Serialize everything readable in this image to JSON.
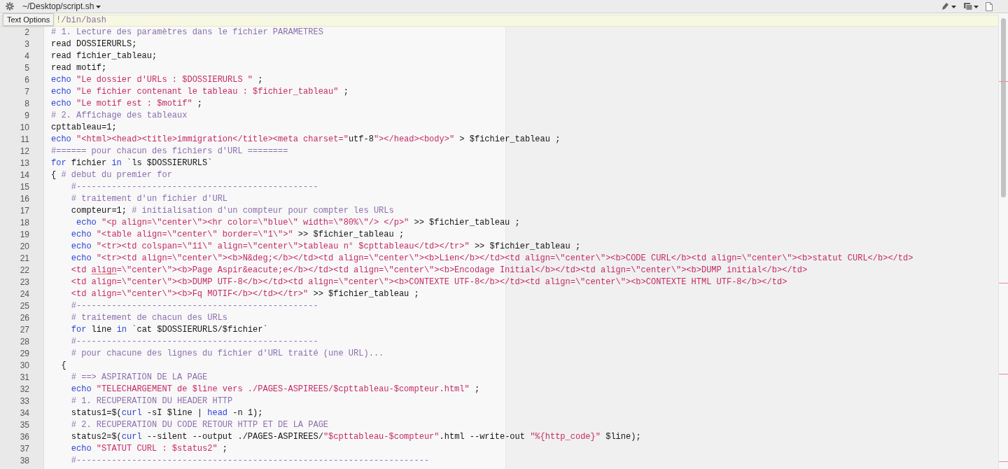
{
  "top_bar": {
    "file_path": "~/Desktop/script.sh",
    "tooltip": "Text Options"
  },
  "lines": [
    {
      "current": true,
      "tokens": [
        {
          "kind": "comment",
          "text": "!/bin/bash"
        }
      ]
    },
    {
      "n": "2",
      "current": false,
      "tokens": [
        {
          "kind": "comment",
          "text": "# 1. Lecture des paramètres dans le fichier PARAMETRES"
        }
      ]
    },
    {
      "n": "3",
      "current": false,
      "tokens": [
        {
          "kind": "plain",
          "text": "read DOSSIERURLS;"
        }
      ]
    },
    {
      "n": "4",
      "current": false,
      "tokens": [
        {
          "kind": "plain",
          "text": "read fichier_tableau;"
        }
      ]
    },
    {
      "n": "5",
      "current": false,
      "tokens": [
        {
          "kind": "plain",
          "text": "read motif;"
        }
      ]
    },
    {
      "n": "6",
      "current": false,
      "tokens": [
        {
          "kind": "keyword",
          "text": "echo "
        },
        {
          "kind": "string",
          "text": "\"Le dossier d'URLs : $DOSSIERURLS \""
        },
        {
          "kind": "plain",
          "text": " ;"
        }
      ]
    },
    {
      "n": "7",
      "current": false,
      "tokens": [
        {
          "kind": "keyword",
          "text": "echo "
        },
        {
          "kind": "string",
          "text": "\"Le fichier contenant le tableau : $fichier_tableau\""
        },
        {
          "kind": "plain",
          "text": " ;"
        }
      ]
    },
    {
      "n": "8",
      "current": false,
      "tokens": [
        {
          "kind": "keyword",
          "text": "echo "
        },
        {
          "kind": "string",
          "text": "\"Le motif est : $motif\""
        },
        {
          "kind": "plain",
          "text": " ;"
        }
      ]
    },
    {
      "n": "9",
      "current": false,
      "tokens": [
        {
          "kind": "comment",
          "text": "# 2. Affichage des tableaux"
        }
      ]
    },
    {
      "n": "10",
      "current": false,
      "tokens": [
        {
          "kind": "plain",
          "text": "cpttableau=1;"
        }
      ]
    },
    {
      "n": "11",
      "current": false,
      "tokens": [
        {
          "kind": "keyword",
          "text": "echo "
        },
        {
          "kind": "string",
          "text": "\"<html><head><title>immigration</title><meta charset=\""
        },
        {
          "kind": "plain",
          "text": "utf-8"
        },
        {
          "kind": "string",
          "text": "\"></head><body>\""
        },
        {
          "kind": "plain",
          "text": " > $fichier_tableau ;"
        }
      ]
    },
    {
      "n": "12",
      "current": false,
      "tokens": [
        {
          "kind": "comment",
          "text": "#====== pour chacun des fichiers d'URL ========"
        }
      ]
    },
    {
      "n": "13",
      "current": false,
      "tokens": [
        {
          "kind": "keyword",
          "text": "for"
        },
        {
          "kind": "plain",
          "text": " fichier "
        },
        {
          "kind": "keyword",
          "text": "in"
        },
        {
          "kind": "plain",
          "text": " `ls $DOSSIERURLS`"
        }
      ]
    },
    {
      "n": "14",
      "current": false,
      "tokens": [
        {
          "kind": "plain",
          "text": "{ "
        },
        {
          "kind": "comment",
          "text": "# debut du premier for"
        }
      ]
    },
    {
      "n": "15",
      "current": false,
      "tokens": [
        {
          "kind": "comment",
          "text": "    #------------------------------------------------"
        }
      ]
    },
    {
      "n": "16",
      "current": false,
      "tokens": [
        {
          "kind": "comment",
          "text": "    # traitement d'un fichier d'URL"
        }
      ]
    },
    {
      "n": "17",
      "current": false,
      "tokens": [
        {
          "kind": "plain",
          "text": "    compteur=1; "
        },
        {
          "kind": "comment",
          "text": "# initialisation d'un compteur pour compter les URLs"
        }
      ]
    },
    {
      "n": "18",
      "current": false,
      "tokens": [
        {
          "kind": "keyword",
          "text": "     echo "
        },
        {
          "kind": "string",
          "text": "\"<p align=\\\"center\\\"><hr color=\\\"blue\\\" width=\\\"80%\\\"/> </p>\""
        },
        {
          "kind": "plain",
          "text": " >> $fichier_tableau ;"
        }
      ]
    },
    {
      "n": "19",
      "current": false,
      "tokens": [
        {
          "kind": "keyword",
          "text": "    echo "
        },
        {
          "kind": "string",
          "text": "\"<table align=\\\"center\\\" border=\\\"1\\\">\""
        },
        {
          "kind": "plain",
          "text": " >> $fichier_tableau ;"
        }
      ]
    },
    {
      "n": "20",
      "current": false,
      "tokens": [
        {
          "kind": "keyword",
          "text": "    echo "
        },
        {
          "kind": "string",
          "text": "\"<tr><td colspan=\\\"11\\\" align=\\\"center\\\">tableau n° $cpttableau</td></tr>\""
        },
        {
          "kind": "plain",
          "text": " >> $fichier_tableau ;"
        }
      ]
    },
    {
      "n": "21",
      "current": false,
      "tokens": [
        {
          "kind": "keyword",
          "text": "    echo "
        },
        {
          "kind": "string",
          "text": "\"<tr><td align=\\\"center\\\"><b>N&deg;</b></td><td align=\\\"center\\\"><b>Lien</b></td><td align=\\\"center\\\"><b>CODE CURL</b><td align=\\\"center\\\"><b>statut CURL</b></td>"
        }
      ]
    },
    {
      "n": "22",
      "current": false,
      "tokens": [
        {
          "kind": "string",
          "text": "    <td "
        },
        {
          "kind": "misspelled",
          "text": "align"
        },
        {
          "kind": "string",
          "text": "=\\\"center\\\"><b>Page Aspir&eacute;e</b></td><td align=\\\"center\\\"><b>Encodage Initial</b></td><td align=\\\"center\\\"><b>DUMP initial</b></td>"
        }
      ]
    },
    {
      "n": "23",
      "current": false,
      "tokens": [
        {
          "kind": "string",
          "text": "    <td align=\\\"center\\\"><b>DUMP UTF-8</b></td><td align=\\\"center\\\"><b>CONTEXTE UTF-8</b></td><td align=\\\"center\\\"><b>CONTEXTE HTML UTF-8</b></td>"
        }
      ]
    },
    {
      "n": "24",
      "current": false,
      "tokens": [
        {
          "kind": "string",
          "text": "    <td align=\\\"center\\\"><b>Fq MOTIF</b></td></tr>\""
        },
        {
          "kind": "plain",
          "text": " >> $fichier_tableau ;"
        }
      ]
    },
    {
      "n": "25",
      "current": false,
      "tokens": [
        {
          "kind": "comment",
          "text": "    #------------------------------------------------"
        }
      ]
    },
    {
      "n": "26",
      "current": false,
      "tokens": [
        {
          "kind": "comment",
          "text": "    # traitement de chacun des URLs"
        }
      ]
    },
    {
      "n": "27",
      "current": false,
      "tokens": [
        {
          "kind": "keyword",
          "text": "    for"
        },
        {
          "kind": "plain",
          "text": " line "
        },
        {
          "kind": "keyword",
          "text": "in"
        },
        {
          "kind": "plain",
          "text": " `cat $DOSSIERURLS/$fichier`"
        }
      ]
    },
    {
      "n": "28",
      "current": false,
      "tokens": [
        {
          "kind": "comment",
          "text": "    #------------------------------------------------"
        }
      ]
    },
    {
      "n": "29",
      "current": false,
      "tokens": [
        {
          "kind": "comment",
          "text": "    # pour chacune des lignes du fichier d'URL traité (une URL)..."
        }
      ]
    },
    {
      "n": "30",
      "current": false,
      "tokens": [
        {
          "kind": "plain",
          "text": "  {"
        }
      ]
    },
    {
      "n": "31",
      "current": false,
      "tokens": [
        {
          "kind": "comment",
          "text": "    # ==> ASPIRATION DE LA PAGE"
        }
      ]
    },
    {
      "n": "32",
      "current": false,
      "tokens": [
        {
          "kind": "keyword",
          "text": "    echo "
        },
        {
          "kind": "string",
          "text": "\"TELECHARGEMENT de $line vers ./PAGES-ASPIREES/$cpttableau-$compteur.html\""
        },
        {
          "kind": "plain",
          "text": " ;"
        }
      ]
    },
    {
      "n": "33",
      "current": false,
      "tokens": [
        {
          "kind": "comment",
          "text": "    # 1. RECUPERATION DU HEADER HTTP"
        }
      ]
    },
    {
      "n": "34",
      "current": false,
      "tokens": [
        {
          "kind": "plain",
          "text": "    status1=$("
        },
        {
          "kind": "keyword",
          "text": "curl"
        },
        {
          "kind": "plain",
          "text": " -sI $line | "
        },
        {
          "kind": "keyword",
          "text": "head"
        },
        {
          "kind": "plain",
          "text": " -n 1);"
        }
      ]
    },
    {
      "n": "35",
      "current": false,
      "tokens": [
        {
          "kind": "comment",
          "text": "    # 2. RECUPERATION DU CODE RETOUR HTTP ET DE LA PAGE"
        }
      ]
    },
    {
      "n": "36",
      "current": false,
      "tokens": [
        {
          "kind": "plain",
          "text": "    status2=$("
        },
        {
          "kind": "keyword",
          "text": "curl"
        },
        {
          "kind": "plain",
          "text": " --silent --output ./PAGES-ASPIREES/"
        },
        {
          "kind": "string",
          "text": "\"$cpttableau-$compteur\""
        },
        {
          "kind": "plain",
          "text": ".html --write-out "
        },
        {
          "kind": "string",
          "text": "\"%{http_code}\""
        },
        {
          "kind": "plain",
          "text": " $line);"
        }
      ]
    },
    {
      "n": "37",
      "current": false,
      "tokens": [
        {
          "kind": "keyword",
          "text": "    echo "
        },
        {
          "kind": "string",
          "text": "\"STATUT CURL : $status2\""
        },
        {
          "kind": "plain",
          "text": " ;"
        }
      ]
    },
    {
      "n": "38",
      "current": false,
      "tokens": [
        {
          "kind": "comment",
          "text": "    #----------------------------------------------------------------------"
        }
      ]
    }
  ]
}
